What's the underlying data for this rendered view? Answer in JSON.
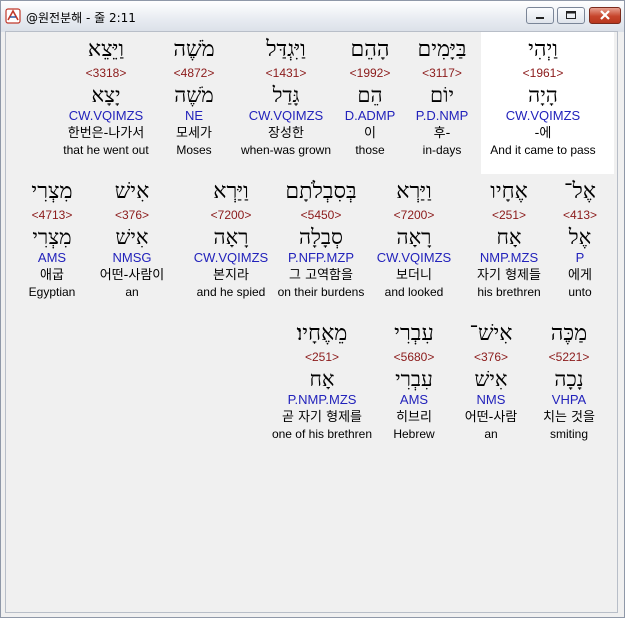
{
  "window": {
    "title": "@원전분해 - 줄 2:11"
  },
  "colors": {
    "strong": "#8b1a1a",
    "parse": "#2222bb",
    "highlight": "#ffffff"
  },
  "rows": [
    {
      "words": [
        {
          "heb": "וַיְהִי",
          "strong": "<1961>",
          "lemma": "הָיָה",
          "parse": "CW.VQIMZS",
          "kor": "-에",
          "eng": "And it came to pass"
        },
        {
          "heb": "בַּיָּמִים",
          "strong": "<3117>",
          "lemma": "יוֹם",
          "parse": "P.D.NMP",
          "kor": "후-",
          "eng": "in-days"
        },
        {
          "heb": "הָהֵם",
          "strong": "<1992>",
          "lemma": "הֵם",
          "parse": "D.ADMP",
          "kor": "이",
          "eng": "those"
        },
        {
          "heb": "וַיִּגְדַּל",
          "strong": "<1431>",
          "lemma": "גָּדַל",
          "parse": "CW.VQIMZS",
          "kor": "장성한",
          "eng": "when-was grown"
        },
        {
          "heb": "מֹשֶׁה",
          "strong": "<4872>",
          "lemma": "מֹשֶׁה",
          "parse": "NE",
          "kor": "모세가",
          "eng": "Moses"
        },
        {
          "heb": "וַיֵּצֵא",
          "strong": "<3318>",
          "lemma": "יָצָא",
          "parse": "CW.VQIMZS",
          "kor": "한번은-나가서",
          "eng": "that he went out"
        }
      ]
    },
    {
      "words": [
        {
          "heb": "אֶל־",
          "strong": "<413>",
          "lemma": "אֶל",
          "parse": "P",
          "kor": "에게",
          "eng": "unto"
        },
        {
          "heb": "אֶחָיו",
          "strong": "<251>",
          "lemma": "אָח",
          "parse": "NMP.MZS",
          "kor": "자기 형제들",
          "eng": "his brethren"
        },
        {
          "heb": "וַיַּרְא",
          "strong": "<7200>",
          "lemma": "רָאָה",
          "parse": "CW.VQIMZS",
          "kor": "보더니",
          "eng": "and looked"
        },
        {
          "heb": "בְּסִבְלֹתָם",
          "strong": "<5450>",
          "lemma": "סְבָלָה",
          "parse": "P.NFP.MZP",
          "kor": "그 고역함을",
          "eng": "on their burdens"
        },
        {
          "heb": "וַיַּרְא",
          "strong": "<7200>",
          "lemma": "רָאָה",
          "parse": "CW.VQIMZS",
          "kor": "본지라",
          "eng": "and he spied"
        },
        {
          "heb": "אִישׁ",
          "strong": "<376>",
          "lemma": "אִישׁ",
          "parse": "NMSG",
          "kor": "어떤-사람이",
          "eng": "an"
        },
        {
          "heb": "מִצְרִי",
          "strong": "<4713>",
          "lemma": "מִצְרִי",
          "parse": "AMS",
          "kor": "애굽",
          "eng": "Egyptian"
        }
      ]
    },
    {
      "words": [
        {
          "heb": "מַכֶּה",
          "strong": "<5221>",
          "lemma": "נָכָה",
          "parse": "VHPA",
          "kor": "치는 것을",
          "eng": "smiting"
        },
        {
          "heb": "אִישׁ־",
          "strong": "<376>",
          "lemma": "אִישׁ",
          "parse": "NMS",
          "kor": "어떤-사람",
          "eng": "an"
        },
        {
          "heb": "עִבְרִי",
          "strong": "<5680>",
          "lemma": "עִבְרִי",
          "parse": "AMS",
          "kor": "히브리",
          "eng": "Hebrew"
        },
        {
          "heb": "מֵאֶחָיו׃",
          "strong": "<251>",
          "lemma": "אָח",
          "parse": "P.NMP.MZS",
          "kor": "곧 자기 형제를",
          "eng": "one of his brethren"
        }
      ]
    }
  ]
}
